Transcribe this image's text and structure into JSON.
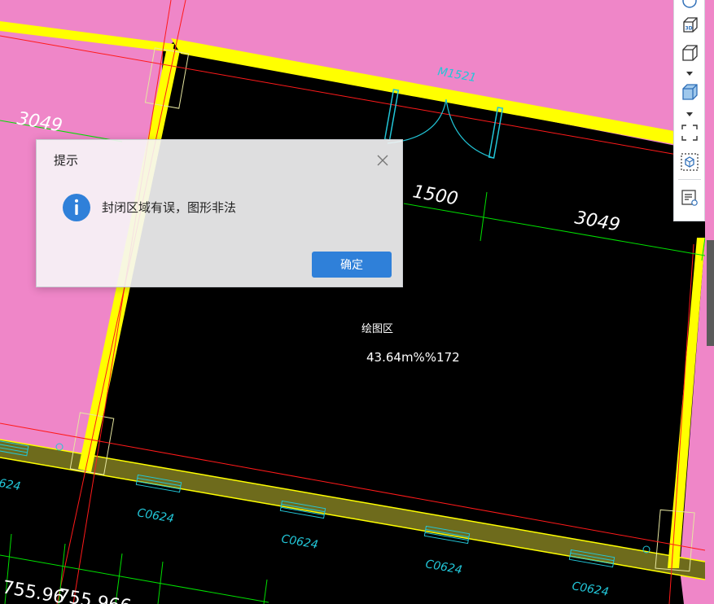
{
  "dialog": {
    "title": "提示",
    "message": "封闭区域有误，图形非法",
    "ok_label": "确定",
    "close_icon": "close-icon",
    "info_icon": "info-icon",
    "accent": "#2f80d9"
  },
  "drawing": {
    "door_label": "M1521",
    "dim_top_left": "3049",
    "dim_1500": "1500",
    "dim_right": "3049",
    "room_name": "绘图区",
    "room_area": "43.64m%%172",
    "window_labels": [
      "624",
      "C0624",
      "C0624",
      "C0624",
      "C0624"
    ],
    "bottom_dims": [
      "755.96",
      "755.96",
      "6"
    ],
    "colors": {
      "background": "#000000",
      "room_fill": "#ef86c8",
      "wall": "#ffff00",
      "window_wall": "#6e6b1c",
      "axis_line": "#ff1a1a",
      "dimension": "#00e000",
      "annotation": "#22c6d8",
      "text": "#ffffff"
    }
  },
  "toolbar": {
    "items": [
      {
        "name": "view-3d-icon"
      },
      {
        "name": "box-view-icon"
      },
      {
        "name": "solid-box-icon"
      },
      {
        "name": "select-region-icon"
      },
      {
        "name": "component-select-icon"
      },
      {
        "name": "property-list-icon"
      }
    ]
  }
}
